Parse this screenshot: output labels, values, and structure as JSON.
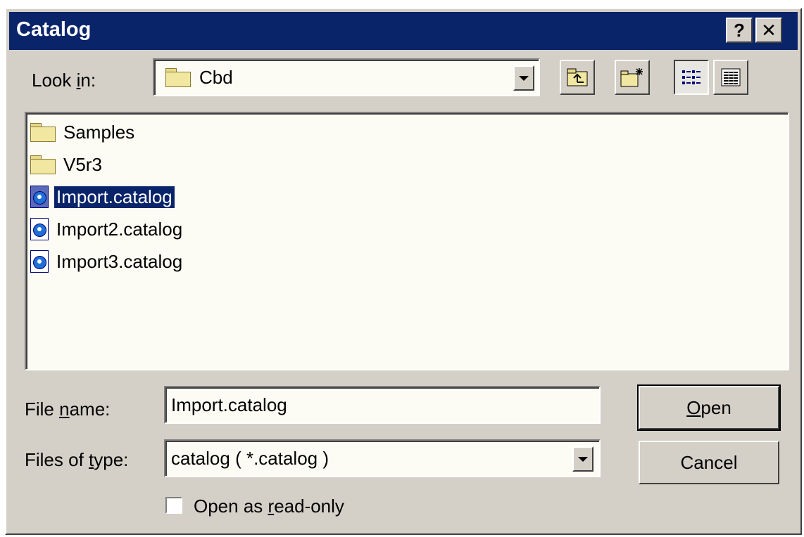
{
  "window": {
    "title": "Catalog",
    "help_label": "?",
    "close_label": "✕"
  },
  "look_in": {
    "label_pre": "Look ",
    "label_key": "i",
    "label_post": "n:",
    "value": "Cbd"
  },
  "toolbar": {
    "icons": [
      "up-one-level-icon",
      "create-new-folder-icon",
      "list-view-icon",
      "details-view-icon"
    ],
    "active_view": "list"
  },
  "files": [
    {
      "type": "folder",
      "name": "Samples"
    },
    {
      "type": "folder",
      "name": "V5r3"
    },
    {
      "type": "catalog",
      "name": "Import.catalog",
      "selected": true
    },
    {
      "type": "catalog",
      "name": "Import2.catalog"
    },
    {
      "type": "catalog",
      "name": "Import3.catalog"
    }
  ],
  "file_name": {
    "label_pre": "File ",
    "label_key": "n",
    "label_post": "ame:",
    "value": "Import.catalog"
  },
  "file_type": {
    "label_pre": "Files of ",
    "label_key": "t",
    "label_post": "ype:",
    "value": "catalog ( *.catalog )"
  },
  "buttons": {
    "open_key": "O",
    "open_rest": "pen",
    "cancel": "Cancel"
  },
  "read_only": {
    "label_pre": "Open as ",
    "label_key": "r",
    "label_post": "ead-only",
    "checked": false
  }
}
